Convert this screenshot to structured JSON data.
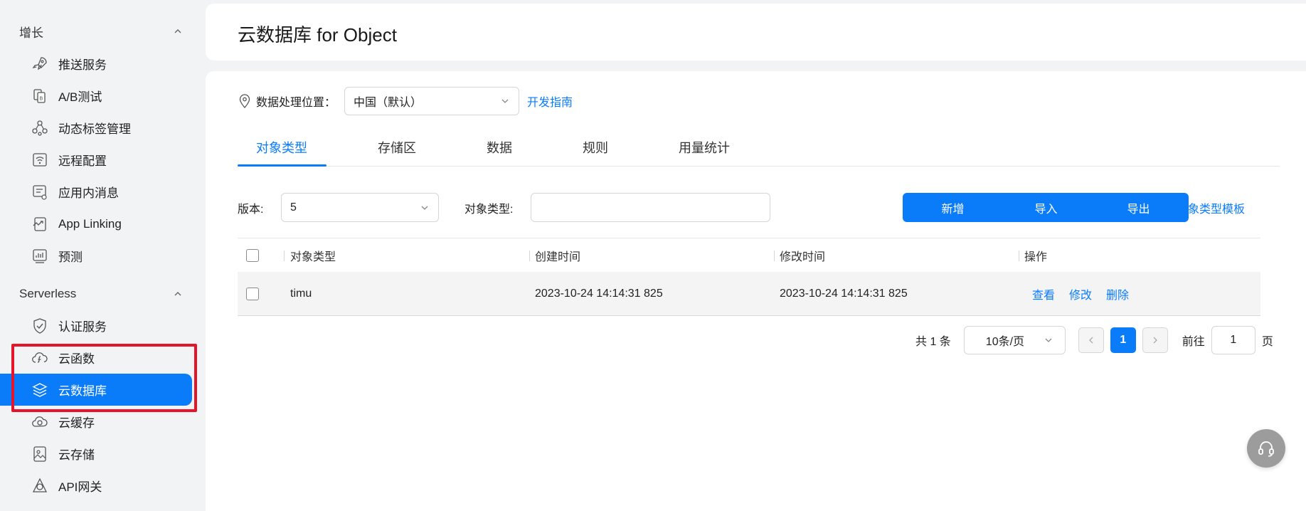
{
  "colors": {
    "accent": "#0a7cfa",
    "highlight": "#e5142b"
  },
  "sidebar": {
    "groups": [
      {
        "label": "增长",
        "items": [
          {
            "label": "推送服务",
            "icon": "rocket-icon"
          },
          {
            "label": "A/B测试",
            "icon": "ab-test-icon"
          },
          {
            "label": "动态标签管理",
            "icon": "nodes-icon"
          },
          {
            "label": "远程配置",
            "icon": "remote-config-icon"
          },
          {
            "label": "应用内消息",
            "icon": "message-icon"
          },
          {
            "label": "App Linking",
            "icon": "link-icon"
          },
          {
            "label": "预测",
            "icon": "prediction-icon"
          }
        ]
      },
      {
        "label": "Serverless",
        "items": [
          {
            "label": "认证服务",
            "icon": "shield-icon"
          },
          {
            "label": "云函数",
            "icon": "cloud-function-icon"
          },
          {
            "label": "云数据库",
            "icon": "database-icon",
            "active": true
          },
          {
            "label": "云缓存",
            "icon": "cloud-cache-icon"
          },
          {
            "label": "云存储",
            "icon": "cloud-storage-icon"
          },
          {
            "label": "API网关",
            "icon": "api-gateway-icon"
          }
        ]
      }
    ]
  },
  "header": {
    "title": "云数据库 for Object"
  },
  "location": {
    "label": "数据处理位置：",
    "value": "中国（默认）",
    "guide_link": "开发指南"
  },
  "tabs": [
    {
      "label": "对象类型",
      "active": true
    },
    {
      "label": "存储区"
    },
    {
      "label": "数据"
    },
    {
      "label": "规则"
    },
    {
      "label": "用量统计"
    }
  ],
  "filters": {
    "version_label": "版本:",
    "version_value": "5",
    "object_type_label": "对象类型:",
    "object_type_value": ""
  },
  "actions": {
    "add": "新增",
    "import": "导入",
    "export": "导出",
    "template_link": "对象类型模板"
  },
  "table": {
    "columns": [
      "对象类型",
      "创建时间",
      "修改时间",
      "操作"
    ],
    "rows": [
      {
        "object_type": "timu",
        "created": "2023-10-24 14:14:31 825",
        "modified": "2023-10-24 14:14:31 825",
        "ops": [
          "查看",
          "修改",
          "删除"
        ]
      }
    ]
  },
  "pagination": {
    "total": "共 1 条",
    "page_size": "10条/页",
    "current_page": "1",
    "goto_label": "前往",
    "goto_value": "1",
    "page_suffix": "页"
  }
}
